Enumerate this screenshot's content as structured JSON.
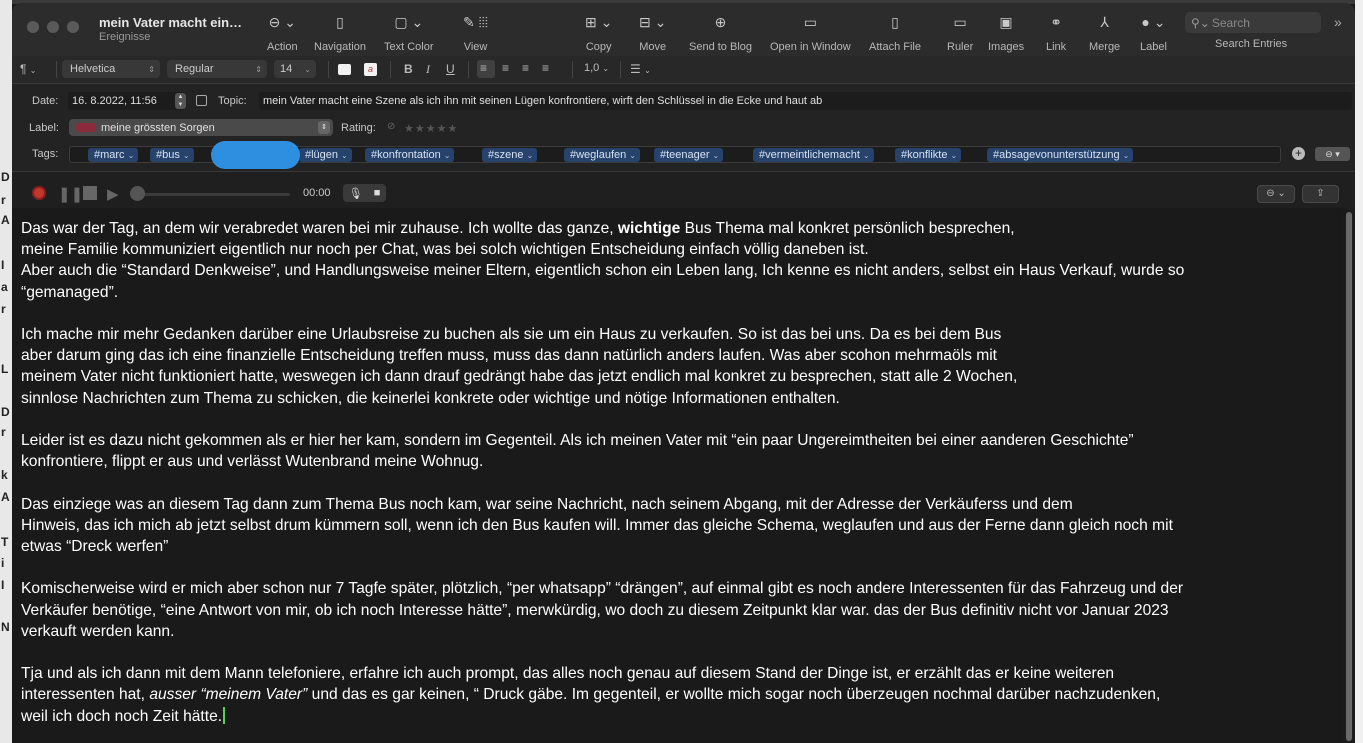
{
  "window": {
    "title": "mein Vater macht ein…",
    "subtitle": "Ereignisse"
  },
  "toolbar": {
    "items": [
      {
        "label": "Action",
        "icon": "ellipsis-circle-icon"
      },
      {
        "label": "Navigation",
        "icon": "sidebar-icon"
      },
      {
        "label": "Text Color",
        "icon": "text-color-icon"
      },
      {
        "label": "View",
        "icon": "pencil-icon"
      },
      {
        "label": "Copy",
        "icon": "copy-icon"
      },
      {
        "label": "Move",
        "icon": "move-icon"
      },
      {
        "label": "Send to Blog",
        "icon": "globe-icon"
      },
      {
        "label": "Open in Window",
        "icon": "window-icon"
      },
      {
        "label": "Attach File",
        "icon": "attach-file-icon"
      },
      {
        "label": "Ruler",
        "icon": "ruler-icon"
      },
      {
        "label": "Images",
        "icon": "image-icon"
      },
      {
        "label": "Link",
        "icon": "link-icon"
      },
      {
        "label": "Merge",
        "icon": "merge-icon"
      },
      {
        "label": "Label",
        "icon": "label-dot-icon"
      }
    ],
    "search_placeholder": "Search",
    "search_label": "Search Entries"
  },
  "format": {
    "paragraph": "¶",
    "font": "Helvetica",
    "style": "Regular",
    "size": "14",
    "bold": "B",
    "italic": "I",
    "underline": "U",
    "line_spacing": "1,0"
  },
  "meta": {
    "date_label": "Date:",
    "date_value": "16. 8.2022, 11:56",
    "topic_label": "Topic:",
    "topic_value": "mein Vater macht eine Szene als ich ihn mit seinen Lügen konfrontiere, wirft den Schlüssel in die Ecke und haut ab",
    "label_label": "Label:",
    "label_value": "meine grössten Sorgen",
    "label_color": "#8a2a3a",
    "rating_label": "Rating:",
    "rating_stars": 0,
    "tags_label": "Tags:",
    "tags": [
      "#marc",
      "#bus",
      "#lügen",
      "#konfrontation",
      "#szene",
      "#weglaufen",
      "#teenager",
      "#vermeintlichemacht",
      "#konflikte",
      "#absagevonunterstützung"
    ]
  },
  "media": {
    "time": "00:00"
  },
  "body": {
    "paragraphs": [
      {
        "lines": [
          [
            "Das war der Tag, an dem wir verabredet waren bei mir zuhause. Ich wollte das ganze, ",
            {
              "b": "wichtige"
            },
            " Bus Thema mal konkret persönlich besprechen,"
          ],
          [
            "meine Familie kommuniziert eigentlich nur noch per Chat, was bei solch wichtigen Entscheidung einfach völlig daneben ist."
          ],
          [
            "Aber auch die “Standard Denkweise”, und Handlungsweise meiner Eltern, eigentlich schon ein Leben lang, Ich kenne es nicht anders, selbst ein Haus Verkauf, wurde so"
          ],
          [
            "“gemanaged”."
          ]
        ]
      },
      {
        "lines": [
          [
            "Ich mache mir mehr Gedanken darüber eine Urlaubsreise zu buchen als sie um ein Haus zu verkaufen. So ist das bei uns. Da es bei dem Bus"
          ],
          [
            "aber darum ging das ich eine finanzielle Entscheidung treffen muss, muss das dann natürlich anders laufen. Was aber scohon mehrmaöls mit"
          ],
          [
            "meinem Vater nicht funktioniert hatte, weswegen ich dann drauf gedrängt habe das jetzt endlich mal konkret zu besprechen, statt alle 2 Wochen,"
          ],
          [
            "sinnlose Nachrichten zum Thema zu schicken, die keinerlei konkrete oder wichtige und nötige Informationen enthalten."
          ]
        ]
      },
      {
        "lines": [
          [
            "Leider ist es dazu nicht gekommen als er hier her kam, sondern im Gegenteil. Als ich meinen Vater mit “ein paar Ungereimtheiten bei einer aanderen Geschichte”"
          ],
          [
            "konfrontiere, flippt er aus und verlässt Wutenbrand meine Wohnug."
          ]
        ]
      },
      {
        "lines": [
          [
            "Das einziege was an diesem Tag dann zum Thema Bus noch kam, war seine Nachricht, nach seinem Abgang, mit der Adresse der Verkäuferss und dem"
          ],
          [
            "Hinweis, das ich mich ab jetzt selbst drum kümmern soll, wenn ich den Bus kaufen will. Immer das gleiche Schema, weglaufen und aus der Ferne dann gleich noch mit"
          ],
          [
            "etwas “Dreck werfen”"
          ]
        ]
      },
      {
        "lines": [
          [
            "Komischerweise wird er mich aber schon nur 7 Tagfe später, plötzlich, “per whatsapp”  “drängen”, auf einmal gibt es noch andere Interessenten für das Fahrzeug und der"
          ],
          [
            "Verkäufer benötige, “eine Antwort von mir, ob ich noch Interesse hätte”, merwkürdig, wo doch zu diesem Zeitpunkt klar war. das der Bus definitiv nicht vor Januar 2023"
          ],
          [
            "verkauft werden kann."
          ]
        ]
      },
      {
        "lines": [
          [
            "Tja und als ich dann mit dem Mann telefoniere, erfahre ich auch prompt, das alles noch genau auf diesem Stand der Dinge ist, er erzählt das er keine weiteren"
          ],
          [
            "interessenten hat,  ",
            {
              "i": "ausser “meinem Vater”"
            },
            "  und das es gar keinen, “ Druck gäbe. Im gegenteil, er wollte mich sogar noch überzeugen nochmal darüber nachzudenken,"
          ],
          [
            "weil ich doch noch Zeit hätte."
          ]
        ]
      }
    ]
  },
  "background_window": {
    "letters": [
      "D",
      "r",
      "A",
      "I",
      "a",
      "r",
      "L",
      "D",
      "r",
      "k",
      "A",
      "T",
      "i",
      "I",
      "N"
    ]
  }
}
